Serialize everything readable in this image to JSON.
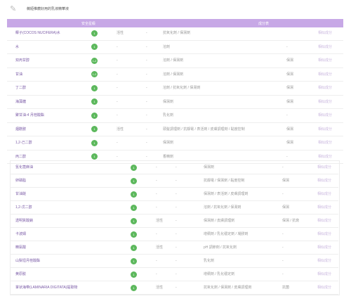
{
  "header": {
    "icon": "document-icon",
    "title": "薇婭推薦好用的乳液精華液"
  },
  "columns": {
    "safety": "安全星級",
    "ingredients": "成分表"
  },
  "colors": {
    "header_bg": "#c7a8e6",
    "badge_green": "#5cb85c",
    "name_purple": "#7a5aa6",
    "link_lilac": "#c9b6de"
  },
  "table1": [
    {
      "name": "椰子(COCOS NUCIFERA)水",
      "score": "1",
      "active": "活性",
      "acne": "-",
      "purpose": "抗氧化劑 / 保濕劑",
      "note": "",
      "link": "相似成分"
    },
    {
      "name": "水",
      "score": "1",
      "active": "-",
      "acne": "-",
      "purpose": "溶劑",
      "note": "-",
      "link": "相似成分"
    },
    {
      "name": "双丙甘醇",
      "score": "1-2",
      "active": "-",
      "acne": "-",
      "purpose": "溶劑 / 保濕劑",
      "note": "保濕",
      "link": "相似成分"
    },
    {
      "name": "甘油",
      "score": "1-2",
      "active": "-",
      "acne": "-",
      "purpose": "溶劑 / 保濕劑",
      "note": "保濕",
      "link": "相似成分"
    },
    {
      "name": "丁二醇",
      "score": "1",
      "active": "-",
      "acne": "-",
      "purpose": "溶劑 / 抗氧化劑 / 保濕劑",
      "note": "保濕",
      "link": "相似成分"
    },
    {
      "name": "海藻糖",
      "score": "1",
      "active": "-",
      "acne": "-",
      "purpose": "保濕劑",
      "note": "保濕",
      "link": "相似成分"
    },
    {
      "name": "聚甘油-4 月桂酸酯",
      "score": "1",
      "active": "-",
      "acne": "-",
      "purpose": "乳化劑",
      "note": "-",
      "link": "相似成分"
    },
    {
      "name": "烟酰胺",
      "score": "1",
      "active": "活性",
      "acne": "-",
      "purpose": "頭髮調理劑 / 抗靜電 / 表活劑 / 皮膚調理劑 / 黏度控制",
      "note": "保濕",
      "link": "相似成分"
    },
    {
      "name": "1,2-己二醇",
      "score": "1",
      "active": "-",
      "acne": "-",
      "purpose": "保濕劑",
      "note": "保濕",
      "link": "相似成分"
    },
    {
      "name": "丙二醇",
      "score": "1",
      "active": "-",
      "acne": "-",
      "purpose": "香精劑",
      "note": "-",
      "link": "相似成分"
    }
  ],
  "table2": [
    {
      "name": "氫化蓖麻油",
      "score": "1",
      "active": "-",
      "acne": "-",
      "purpose": "保濕劑",
      "note": "-",
      "link": "相似成分"
    },
    {
      "name": "卵磷脂",
      "score": "1",
      "active": "-",
      "acne": "-",
      "purpose": "抗靜電 / 保濕劑 / 黏度控制",
      "note": "保濕",
      "link": "相似成分"
    },
    {
      "name": "甘油醚",
      "score": "1",
      "active": "-",
      "acne": "-",
      "purpose": "保濕劑 / 表活劑 / 皮膚調理劑",
      "note": "-",
      "link": "相似成分"
    },
    {
      "name": "1,2-戊二醇",
      "score": "1",
      "active": "-",
      "acne": "-",
      "purpose": "溶劑 / 抗氧化劑 / 保濕劑",
      "note": "保濕",
      "link": "相似成分"
    },
    {
      "name": "透明質酸鈉",
      "score": "1",
      "active": "活性",
      "acne": "-",
      "purpose": "保濕劑 / 皮膚調理劑",
      "note": "保濕 / 抗衰",
      "link": "相似成分"
    },
    {
      "name": "卡波姆",
      "score": "1",
      "active": "-",
      "acne": "-",
      "purpose": "增稠劑 / 乳化穩定劑 / 凝膠劑",
      "note": "-",
      "link": "相似成分"
    },
    {
      "name": "精氨酸",
      "score": "1",
      "active": "活性",
      "acne": "-",
      "purpose": "pH 調節劑 / 抗氧化劑",
      "note": "-",
      "link": "相似成分"
    },
    {
      "name": "山梨坦月桂酸酯",
      "score": "1",
      "active": "-",
      "acne": "-",
      "purpose": "乳化劑",
      "note": "-",
      "link": "相似成分"
    },
    {
      "name": "黄原胶",
      "score": "1",
      "active": "-",
      "acne": "-",
      "purpose": "增稠劑 / 乳化穩定劑",
      "note": "-",
      "link": "相似成分"
    },
    {
      "name": "掌状海带(LAMINARIA DIGITATA)提取物",
      "score": "1",
      "active": "活性",
      "acne": "-",
      "purpose": "抗氧化劑 / 保濕劑 / 皮膚調理劑",
      "note": "抗菌",
      "link": "相似成分"
    }
  ]
}
